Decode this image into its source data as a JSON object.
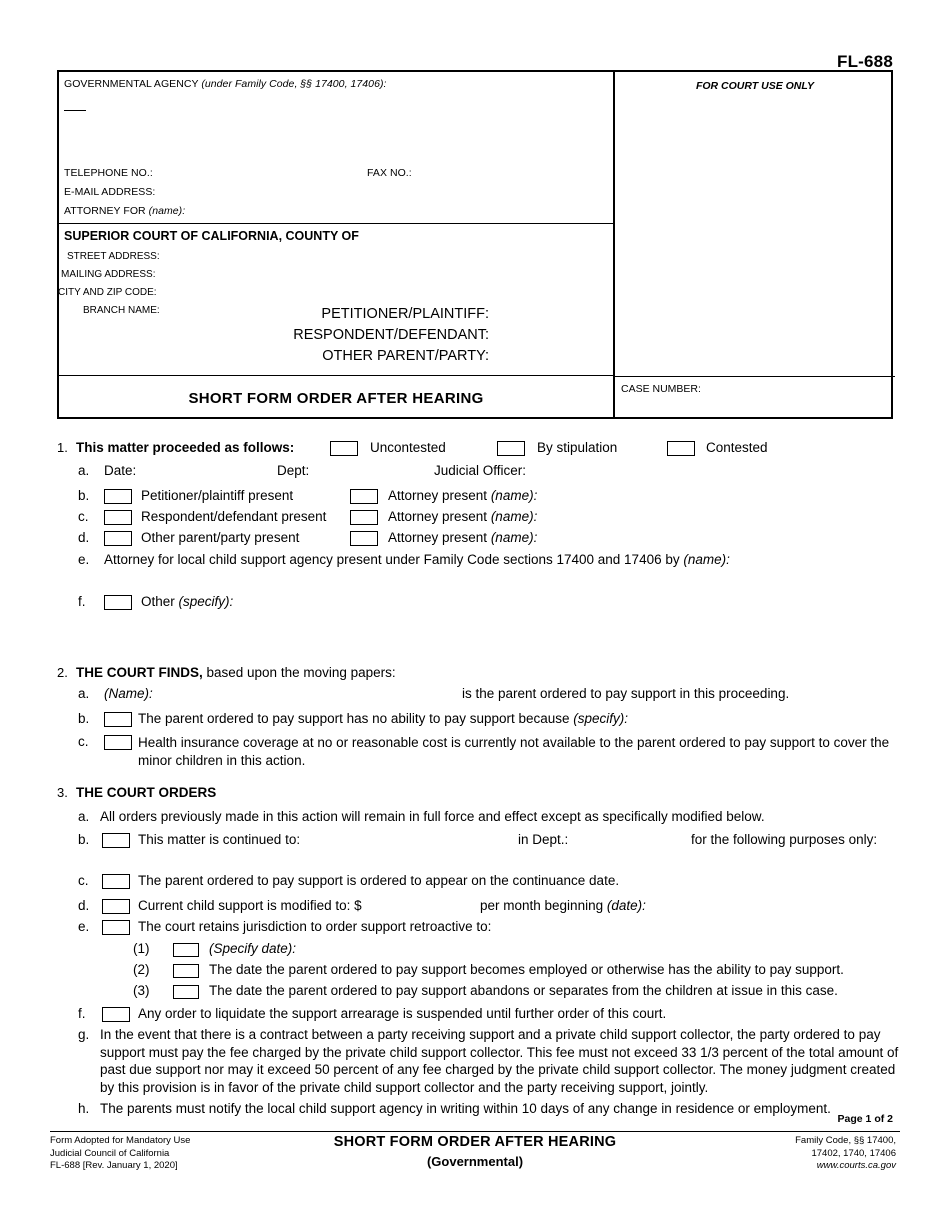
{
  "form_number": "FL-688",
  "caption": {
    "agency_label": "GOVERNMENTAL AGENCY ",
    "agency_label_italic": "(under Family Code, §§ 17400, 17406):",
    "telephone_label": "TELEPHONE NO.:",
    "fax_label": "FAX NO.:",
    "email_label": "E-MAIL ADDRESS:",
    "attorney_for_label": "ATTORNEY FOR ",
    "attorney_for_italic": "(name):",
    "court_title": "SUPERIOR COURT OF CALIFORNIA, COUNTY OF",
    "street_address_label": "STREET ADDRESS:",
    "mailing_address_label": "MAILING ADDRESS:",
    "city_zip_label": "CITY AND ZIP CODE:",
    "branch_name_label": "BRANCH NAME:",
    "petitioner_label": "PETITIONER/PLAINTIFF:",
    "respondent_label": "RESPONDENT/DEFENDANT:",
    "other_parent_label": "OTHER PARENT/PARTY:",
    "form_title": "SHORT FORM ORDER AFTER HEARING",
    "court_use_only": "FOR COURT USE ONLY",
    "case_number_label": "CASE NUMBER:"
  },
  "item1": {
    "number": "1.",
    "heading": "This matter proceeded as follows:",
    "option_uncontested": "Uncontested",
    "option_stipulation": "By stipulation",
    "option_contested": "Contested",
    "a": {
      "letter": "a.",
      "date_label": "Date:",
      "dept_label": "Dept:",
      "judicial_officer_label": "Judicial Officer:"
    },
    "b": {
      "letter": "b.",
      "text": "Petitioner/plaintiff present",
      "attorney_text": "Attorney present ",
      "attorney_italic": "(name):"
    },
    "c": {
      "letter": "c.",
      "text": "Respondent/defendant present",
      "attorney_text": "Attorney present ",
      "attorney_italic": "(name):"
    },
    "d": {
      "letter": "d.",
      "text": "Other parent/party present",
      "attorney_text": "Attorney present ",
      "attorney_italic": "(name):"
    },
    "e": {
      "letter": "e.",
      "text": "Attorney for local child support agency present under Family Code sections 17400 and 17406 by ",
      "italic": "(name):"
    },
    "f": {
      "letter": "f.",
      "text": "Other ",
      "italic": "(specify):"
    }
  },
  "item2": {
    "number": "2.",
    "heading_bold": "THE COURT FINDS,",
    "heading_rest": " based upon the moving papers:",
    "a": {
      "letter": "a.",
      "italic": "(Name):",
      "text": "is the parent ordered to pay support in this proceeding."
    },
    "b": {
      "letter": "b.",
      "text": "The parent ordered to pay support has no ability to pay support because ",
      "italic": "(specify):"
    },
    "c": {
      "letter": "c.",
      "text": "Health insurance coverage at no or reasonable cost is currently not available to the parent ordered to pay support to cover the minor children in this action."
    }
  },
  "item3": {
    "number": "3.",
    "heading": "THE COURT ORDERS",
    "a": {
      "letter": "a.",
      "text": "All orders previously made in this action will remain in full force and effect except as specifically modified below."
    },
    "b": {
      "letter": "b.",
      "text": "This matter is continued to:",
      "dept_text": "in Dept.:",
      "purposes_text": "for the following purposes only:"
    },
    "c": {
      "letter": "c.",
      "text": "The parent ordered to pay support is ordered to appear on the continuance date."
    },
    "d": {
      "letter": "d.",
      "text": "Current child support is modified to: $",
      "per_month_text": "per month beginning ",
      "per_month_italic": "(date):"
    },
    "e": {
      "letter": "e.",
      "text": "The court retains jurisdiction to order support retroactive to:",
      "sub1": {
        "number": "(1)",
        "italic": "(Specify date):"
      },
      "sub2": {
        "number": "(2)",
        "text": "The date the parent ordered to pay support becomes employed or otherwise has the ability to pay support."
      },
      "sub3": {
        "number": "(3)",
        "text": "The date the parent ordered to pay support abandons or separates from the children at issue in this case."
      }
    },
    "f": {
      "letter": "f.",
      "text": "Any order to liquidate the support arrearage is suspended until further order of this court."
    },
    "g": {
      "letter": "g.",
      "text": "In the event that there is a contract between a party receiving support and a private child support collector, the party ordered to pay support must pay the fee charged by the private child support collector. This fee must not exceed 33 1/3 percent of the total amount of past due support nor may it exceed 50 percent of any fee charged by the private child support collector. The money judgment created by this provision is in favor of the private child support collector and the party receiving support, jointly."
    },
    "h": {
      "letter": "h.",
      "text": "The parents must notify the local child support agency in writing within 10 days of any change in residence or employment."
    }
  },
  "footer": {
    "page_of": "Page 1 of 2",
    "left_line1": "Form Adopted for Mandatory Use",
    "left_line2": "Judicial Council of California",
    "left_line3": "FL-688 [Rev. January 1, 2020]",
    "center_line1": "SHORT FORM ORDER AFTER HEARING",
    "center_line2": "(Governmental)",
    "right_line1": "Family Code, §§ 17400,",
    "right_line2": "17402, 1740, 17406",
    "right_line3": "www.courts.ca.gov"
  }
}
